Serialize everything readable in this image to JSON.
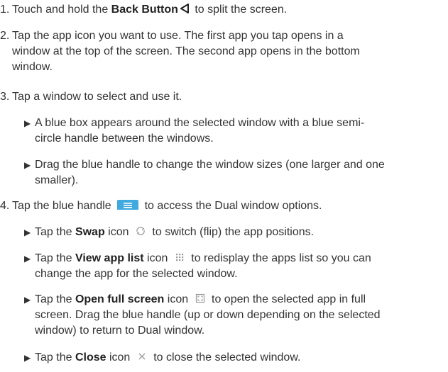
{
  "steps": [
    {
      "num": "1.",
      "pre": "Touch and hold the ",
      "bold": "Back Button",
      "icon": "back-triangle-icon",
      "post": " to split the screen."
    },
    {
      "num": "2.",
      "line1": "Tap the app icon you want to use. The first app you tap opens in a",
      "line2": "window at the top of the screen. The second app opens in the bottom",
      "line3": "window."
    },
    {
      "num": "3.",
      "text": "Tap a window to select and use it.",
      "bullets": [
        {
          "line1": "A blue box appears around the selected window with a blue semi-",
          "line2": "circle handle between the windows."
        },
        {
          "line1": "Drag the blue handle to change the window sizes (one larger and one",
          "line2": "smaller)."
        }
      ]
    },
    {
      "num": "4.",
      "pre": "Tap the blue handle ",
      "icon": "blue-handle-icon",
      "post": " to access the Dual window options.",
      "bullets": [
        {
          "pre": "Tap the ",
          "bold": "Swap",
          "mid": " icon ",
          "icon": "swap-icon",
          "post": " to switch (flip) the app positions."
        },
        {
          "pre": "Tap the ",
          "bold": "View app list",
          "mid": " icon ",
          "icon": "app-list-icon",
          "post": " to redisplay the apps list so you can",
          "line2": "change the app for the selected window."
        },
        {
          "pre": "Tap the ",
          "bold": "Open full screen",
          "mid": " icon ",
          "icon": "full-screen-icon",
          "post": " to open the selected app in full",
          "line2": "screen. Drag the blue handle (up or down depending on the selected",
          "line3": "window) to return to Dual window."
        },
        {
          "pre": "Tap the ",
          "bold": "Close",
          "mid": " icon ",
          "icon": "close-icon",
          "post": " to close the selected window."
        }
      ]
    }
  ],
  "bullet_glyph": "▶",
  "colors": {
    "text": "#333333",
    "handle_blue": "#3fa9e0",
    "icon_gray": "#9a9a9a"
  }
}
